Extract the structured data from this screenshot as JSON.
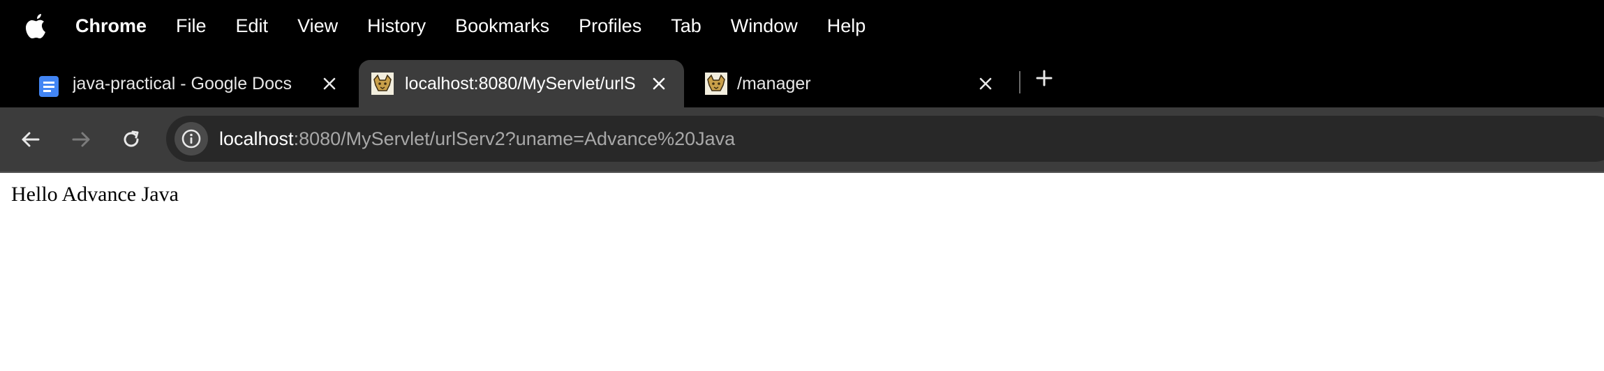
{
  "menubar": {
    "apple_icon": "apple-logo-icon",
    "app_name": "Chrome",
    "items": [
      "File",
      "Edit",
      "View",
      "History",
      "Bookmarks",
      "Profiles",
      "Tab",
      "Window",
      "Help"
    ]
  },
  "tabs": [
    {
      "title": "java-practical - Google Docs",
      "icon": "google-docs-icon",
      "active": false
    },
    {
      "title": "localhost:8080/MyServlet/urlS",
      "icon": "tomcat-icon",
      "active": true
    },
    {
      "title": "/manager",
      "icon": "tomcat-icon",
      "active": false
    }
  ],
  "toolbar": {
    "back_icon": "back-arrow-icon",
    "forward_icon": "forward-arrow-icon",
    "reload_icon": "reload-icon",
    "site_info_icon": "info-icon",
    "url_host": "localhost",
    "url_rest": ":8080/MyServlet/urlServ2?uname=Advance%20Java"
  },
  "page": {
    "content": "Hello Advance Java"
  },
  "colors": {
    "menubar_bg": "#000000",
    "toolbar_bg": "#3c3c3c",
    "omnibox_bg": "#282828",
    "docs_blue": "#4285f4"
  }
}
